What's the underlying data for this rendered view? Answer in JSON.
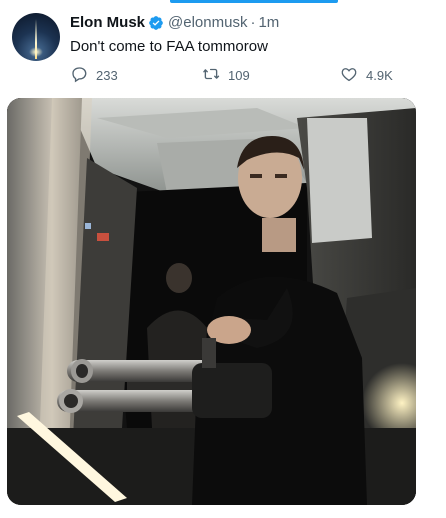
{
  "tweet": {
    "author_name": "Elon Musk",
    "author_handle": "@elonmusk",
    "separator": "·",
    "timestamp": "1m",
    "text": "Don't come to FAA tommorow"
  },
  "actions": {
    "reply_count": "233",
    "retweet_count": "109",
    "like_count": "4.9K"
  },
  "icons": [
    "verified-badge-icon",
    "reply-icon",
    "retweet-icon",
    "like-icon"
  ],
  "colors": {
    "accent": "#1d9bf0",
    "secondary_text": "#536471",
    "primary_text": "#0f1419"
  }
}
